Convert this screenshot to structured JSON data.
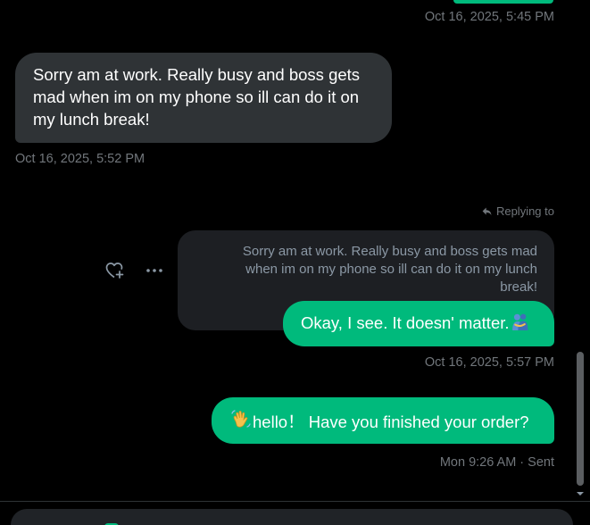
{
  "colors": {
    "background": "#000000",
    "sent_bubble": "#00ba7c",
    "received_bubble": "#2f3336",
    "quote_box": "#1d1f23",
    "meta_text": "#71767b"
  },
  "messages": {
    "prev_sent_timestamp": "Oct 16, 2025, 5:45 PM",
    "received": {
      "text": "Sorry am at work. Really busy and boss gets mad when im on my phone so ill can do it on my lunch break!",
      "timestamp": "Oct 16, 2025, 5:52 PM"
    },
    "reply": {
      "label": "Replying to",
      "quoted_text": "Sorry am at work. Really busy and boss gets mad when im on my phone so ill can do it on my lunch break!",
      "text": "Okay, I see. It doesn' matter.",
      "emoji_icon": "people-hugging-icon",
      "timestamp": "Oct 16, 2025, 5:57 PM"
    },
    "last": {
      "emoji_icon": "waving-hand-icon",
      "text": "hello！ Have you finished your order?",
      "meta": "Mon 9:26 AM · Sent"
    }
  },
  "actions": {
    "react_icon": "add-reaction-icon",
    "more_icon": "more-options-icon"
  }
}
